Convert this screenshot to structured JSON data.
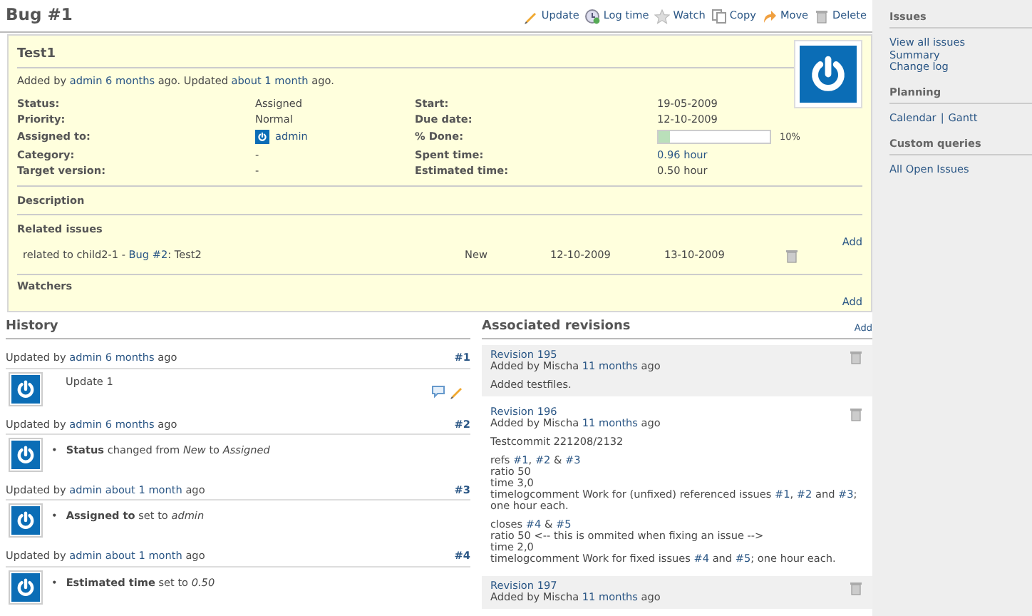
{
  "title": "Bug #1",
  "actions": [
    {
      "label": "Update"
    },
    {
      "label": "Log time"
    },
    {
      "label": "Watch"
    },
    {
      "label": "Copy"
    },
    {
      "label": "Move"
    },
    {
      "label": "Delete"
    }
  ],
  "issue": {
    "subject": "Test1",
    "byline": [
      "Added by ",
      [
        "admin",
        "6 months"
      ],
      " ago. Updated ",
      [
        "about 1 month"
      ],
      " ago."
    ],
    "fields": [
      [
        {
          "label": "Status:",
          "kind": "text",
          "value": "Assigned"
        },
        {
          "label": "Start:",
          "kind": "text",
          "value": "19-05-2009"
        }
      ],
      [
        {
          "label": "Priority:",
          "kind": "text",
          "value": "Normal"
        },
        {
          "label": "Due date:",
          "kind": "text",
          "value": "12-10-2009"
        }
      ],
      [
        {
          "label": "Assigned to:",
          "kind": "user",
          "value": "admin"
        },
        {
          "label": "% Done:",
          "kind": "progress",
          "level": 0.1,
          "reading": "10%"
        }
      ],
      [
        {
          "label": "Category:",
          "kind": "text",
          "value": "-"
        },
        {
          "label": "Spent time:",
          "kind": "link",
          "value": "0.96 hour"
        }
      ],
      [
        {
          "label": "Target version:",
          "kind": "text",
          "value": "-"
        },
        {
          "label": "Estimated time:",
          "kind": "text",
          "value": "0.50 hour"
        }
      ]
    ],
    "sections": [
      {
        "title": "Description"
      },
      {
        "title": "Related issues",
        "action": "Add",
        "relations": [
          {
            "text": [
              "related to child2-1 - ",
              [
                "Bug #2"
              ],
              ": Test2"
            ],
            "status": "New",
            "start": "12-10-2009",
            "due": "13-10-2009"
          }
        ]
      },
      {
        "title": "Watchers",
        "action": "Add"
      }
    ]
  },
  "history": {
    "title": "History",
    "journals": [
      {
        "header": [
          "Updated by ",
          [
            "admin",
            "6 months"
          ],
          " ago"
        ],
        "number": "#1",
        "kind": "note",
        "text": "Update 1"
      },
      {
        "header": [
          "Updated by ",
          [
            "admin",
            "6 months"
          ],
          " ago"
        ],
        "number": "#2",
        "kind": "details",
        "details": [
          {
            "bullet": "•",
            "text": "**Status** changed from *New* to *Assigned*"
          }
        ]
      },
      {
        "header": [
          "Updated by ",
          [
            "admin",
            "about 1 month"
          ],
          " ago"
        ],
        "number": "#3",
        "kind": "details",
        "details": [
          {
            "bullet": "•",
            "text": "**Assigned to** set to *admin*"
          }
        ]
      },
      {
        "header": [
          "Updated by ",
          [
            "admin",
            "about 1 month"
          ],
          " ago"
        ],
        "number": "#4",
        "kind": "details",
        "details": [
          {
            "bullet": "•",
            "text": "**Estimated time** set to *0.50*"
          }
        ]
      }
    ]
  },
  "revisions": {
    "title": "Associated revisions",
    "action": "Add",
    "items": [
      {
        "title": "Revision 195",
        "byline": [
          "Added by Mischa ",
          [
            "11 months"
          ],
          " ago"
        ],
        "paragraphs": [
          [
            [
              "Added testfiles."
            ]
          ]
        ]
      },
      {
        "title": "Revision 196",
        "byline": [
          "Added by Mischa ",
          [
            "11 months"
          ],
          " ago"
        ],
        "paragraphs": [
          [
            [
              "Testcommit 221208/2132"
            ]
          ],
          [
            [
              "refs ",
              [
                "#1"
              ],
              ", ",
              [
                "#2"
              ],
              " & ",
              [
                "#3"
              ]
            ],
            [
              "ratio 50"
            ],
            [
              "time 3,0"
            ],
            [
              "timelogcomment Work for (unfixed) referenced issues ",
              [
                "#1"
              ],
              ", ",
              [
                "#2"
              ],
              " and ",
              [
                "#3"
              ],
              "; one hour each."
            ]
          ],
          [
            [
              "closes ",
              [
                "#4"
              ],
              " & ",
              [
                "#5"
              ]
            ],
            [
              "ratio 50 <-- this is ommited when fixing an issue -->"
            ],
            [
              "time 2,0"
            ],
            [
              "timelogcomment Work for fixed issues ",
              [
                "#4"
              ],
              " and ",
              [
                "#5"
              ],
              "; one hour each."
            ]
          ]
        ]
      },
      {
        "title": "Revision 197",
        "byline": [
          "Added by Mischa ",
          [
            "11 months"
          ],
          " ago"
        ]
      }
    ]
  },
  "sidebar": [
    {
      "title": "Issues",
      "links": [
        "View all issues",
        "Summary",
        "Change log"
      ]
    },
    {
      "title": "Planning",
      "links": [
        "Calendar",
        "Gantt"
      ],
      "separator": "|"
    },
    {
      "title": "Custom queries",
      "links": [
        "All Open Issues"
      ]
    }
  ]
}
